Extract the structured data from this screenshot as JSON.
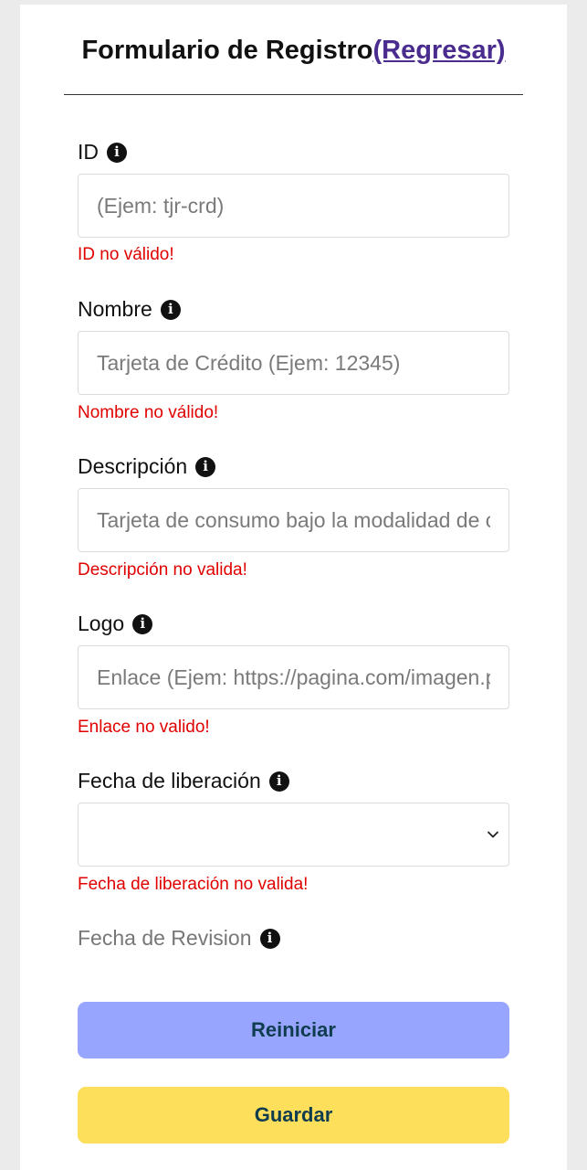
{
  "header": {
    "title": "Formulario de Registro",
    "back_link": "(Regresar)"
  },
  "fields": {
    "id": {
      "label": "ID",
      "placeholder": "(Ejem: tjr-crd)",
      "error": "ID no válido!"
    },
    "name": {
      "label": "Nombre",
      "placeholder": "Tarjeta de Crédito (Ejem: 12345)",
      "error": "Nombre no válido!"
    },
    "description": {
      "label": "Descripción",
      "placeholder": "Tarjeta de consumo bajo la modalidad de crédito",
      "error": "Descripción no valida!"
    },
    "logo": {
      "label": "Logo",
      "placeholder": "Enlace (Ejem: https://pagina.com/imagen.png)",
      "error": "Enlace no valido!"
    },
    "release_date": {
      "label": "Fecha de liberación",
      "value": "",
      "error": "Fecha de liberación no valida!"
    },
    "revision_date": {
      "label": "Fecha de Revision"
    }
  },
  "icons": {
    "info": "info-icon",
    "chevron": "chevron-down-icon"
  },
  "buttons": {
    "reset_label": "Reiniciar",
    "save_label": "Guardar"
  },
  "colors": {
    "error": "#e00000",
    "reset_button": "#97a5fe",
    "save_button": "#fedf5b",
    "button_text": "#0f3d4f",
    "link": "#4a2c8f"
  }
}
